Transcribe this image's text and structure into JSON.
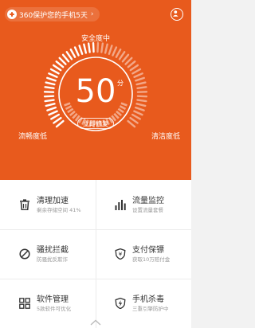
{
  "top_bar": {
    "protection_days": "360保护您的手机5天"
  },
  "gauge": {
    "status": "安全度中",
    "score": "50",
    "score_unit": "分",
    "fix_button": "立即修复",
    "left_label": "流畅度低",
    "right_label": "清洁度低",
    "level_fraction": 0.5
  },
  "features": [
    {
      "title": "清理加速",
      "subtitle": "剩余存储空间 41%",
      "icon": "trash-icon"
    },
    {
      "title": "流量监控",
      "subtitle": "设置流量套餐",
      "icon": "traffic-bars-icon"
    },
    {
      "title": "骚扰拦截",
      "subtitle": "防骚扰反欺诈",
      "icon": "block-icon"
    },
    {
      "title": "支付保镖",
      "subtitle": "获取10万赔付金",
      "icon": "yen-shield-icon"
    },
    {
      "title": "软件管理",
      "subtitle": "5款软件可优化",
      "icon": "apps-grid-icon"
    },
    {
      "title": "手机杀毒",
      "subtitle": "三重引擎防护中",
      "icon": "lightning-shield-icon"
    }
  ],
  "colors": {
    "hero_bg": "#e85a1d",
    "tick_active": "#ffffff",
    "tick_inactive": "#f3a888"
  }
}
